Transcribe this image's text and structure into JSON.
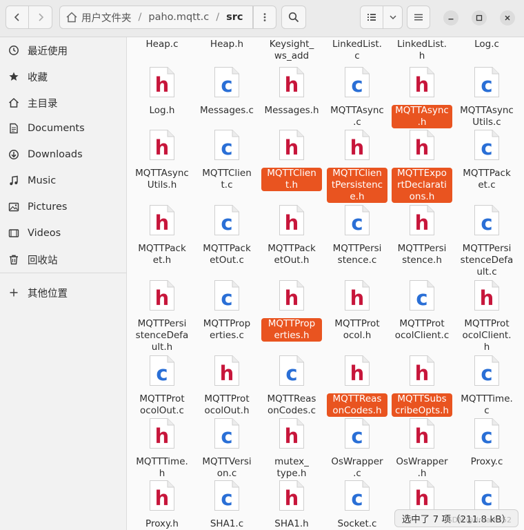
{
  "header": {
    "back_icon": "chevron-left-icon",
    "forward_icon": "chevron-right-icon",
    "path": [
      "用户文件夹",
      "paho.mqtt.c",
      "src"
    ],
    "separator": "/",
    "path_menu_icon": "vertical-dots-icon",
    "search_icon": "search-icon",
    "view_icon": "list-view-icon",
    "view_dropdown_icon": "chevron-down-icon",
    "menu_icon": "hamburger-icon",
    "window_buttons": [
      "minimize-icon",
      "maximize-icon",
      "close-icon"
    ]
  },
  "sidebar": {
    "items": [
      {
        "label": "最近使用",
        "icon": "clock-icon"
      },
      {
        "label": "收藏",
        "icon": "star-icon"
      },
      {
        "label": "主目录",
        "icon": "home-icon"
      },
      {
        "label": "Documents",
        "icon": "document-icon"
      },
      {
        "label": "Downloads",
        "icon": "download-icon"
      },
      {
        "label": "Music",
        "icon": "music-icon"
      },
      {
        "label": "Pictures",
        "icon": "picture-icon"
      },
      {
        "label": "Videos",
        "icon": "video-icon"
      },
      {
        "label": "回收站",
        "icon": "trash-icon"
      }
    ],
    "other": {
      "label": "其他位置",
      "icon": "plus-icon"
    }
  },
  "files": [
    {
      "name": "Heap.c",
      "type": "c",
      "selected": false,
      "partial": true
    },
    {
      "name": "Heap.h",
      "type": "h",
      "selected": false,
      "partial": true
    },
    {
      "name": "Keysight_\nws_add",
      "type": "h",
      "selected": false,
      "partial": true
    },
    {
      "name": "LinkedList.\nc",
      "type": "c",
      "selected": false,
      "partial": true
    },
    {
      "name": "LinkedList.\nh",
      "type": "h",
      "selected": false,
      "partial": true
    },
    {
      "name": "Log.c",
      "type": "c",
      "selected": false,
      "partial": true
    },
    {
      "name": "Log.h",
      "type": "h",
      "selected": false
    },
    {
      "name": "Messages.c",
      "type": "c",
      "selected": false
    },
    {
      "name": "Messages.h",
      "type": "h",
      "selected": false
    },
    {
      "name": "MQTTAsync\n.c",
      "type": "c",
      "selected": false
    },
    {
      "name": "MQTTAsync\n.h",
      "type": "h",
      "selected": true
    },
    {
      "name": "MQTTAsync\nUtils.c",
      "type": "c",
      "selected": false
    },
    {
      "name": "MQTTAsync\nUtils.h",
      "type": "h",
      "selected": false
    },
    {
      "name": "MQTTClien\nt.c",
      "type": "c",
      "selected": false
    },
    {
      "name": "MQTTClien\nt.h",
      "type": "h",
      "selected": true
    },
    {
      "name": "MQTTClien\ntPersistenc\ne.h",
      "type": "h",
      "selected": true
    },
    {
      "name": "MQTTExpo\nrtDeclarati\nons.h",
      "type": "h",
      "selected": true
    },
    {
      "name": "MQTTPack\net.c",
      "type": "c",
      "selected": false
    },
    {
      "name": "MQTTPack\net.h",
      "type": "h",
      "selected": false
    },
    {
      "name": "MQTTPack\netOut.c",
      "type": "c",
      "selected": false
    },
    {
      "name": "MQTTPack\netOut.h",
      "type": "h",
      "selected": false
    },
    {
      "name": "MQTTPersi\nstence.c",
      "type": "c",
      "selected": false
    },
    {
      "name": "MQTTPersi\nstence.h",
      "type": "h",
      "selected": false
    },
    {
      "name": "MQTTPersi\nstenceDefa\nult.c",
      "type": "c",
      "selected": false
    },
    {
      "name": "MQTTPersi\nstenceDefa\nult.h",
      "type": "h",
      "selected": false
    },
    {
      "name": "MQTTProp\nerties.c",
      "type": "c",
      "selected": false
    },
    {
      "name": "MQTTProp\nerties.h",
      "type": "h",
      "selected": true
    },
    {
      "name": "MQTTProt\nocol.h",
      "type": "h",
      "selected": false
    },
    {
      "name": "MQTTProt\nocolClient.c",
      "type": "c",
      "selected": false
    },
    {
      "name": "MQTTProt\nocolClient.\nh",
      "type": "h",
      "selected": false
    },
    {
      "name": "MQTTProt\nocolOut.c",
      "type": "c",
      "selected": false
    },
    {
      "name": "MQTTProt\nocolOut.h",
      "type": "h",
      "selected": false
    },
    {
      "name": "MQTTReas\nonCodes.c",
      "type": "c",
      "selected": false
    },
    {
      "name": "MQTTReas\nonCodes.h",
      "type": "h",
      "selected": true
    },
    {
      "name": "MQTTSubs\ncribeOpts.h",
      "type": "h",
      "selected": true
    },
    {
      "name": "MQTTTime.\nc",
      "type": "c",
      "selected": false
    },
    {
      "name": "MQTTTime.\nh",
      "type": "h",
      "selected": false
    },
    {
      "name": "MQTTVersi\non.c",
      "type": "c",
      "selected": false
    },
    {
      "name": "mutex_\ntype.h",
      "type": "h",
      "selected": false
    },
    {
      "name": "OsWrapper\n.c",
      "type": "c",
      "selected": false
    },
    {
      "name": "OsWrapper\n.h",
      "type": "h",
      "selected": false
    },
    {
      "name": "Proxy.c",
      "type": "c",
      "selected": false
    },
    {
      "name": "Proxy.h",
      "type": "h",
      "selected": false
    },
    {
      "name": "SHA1.c",
      "type": "c",
      "selected": false
    },
    {
      "name": "SHA1.h",
      "type": "h",
      "selected": false
    },
    {
      "name": "Socket.c",
      "type": "c",
      "selected": false
    },
    {
      "name": "",
      "type": "h",
      "selected": false
    },
    {
      "name": "",
      "type": "c",
      "selected": false
    }
  ],
  "colors": {
    "selection": "#e95420",
    "h_letter": "#c7163b",
    "c_letter": "#2a6fd6"
  },
  "status": "选中了 7 项（211.8 kB）",
  "watermark": "CSDN @dreams52"
}
